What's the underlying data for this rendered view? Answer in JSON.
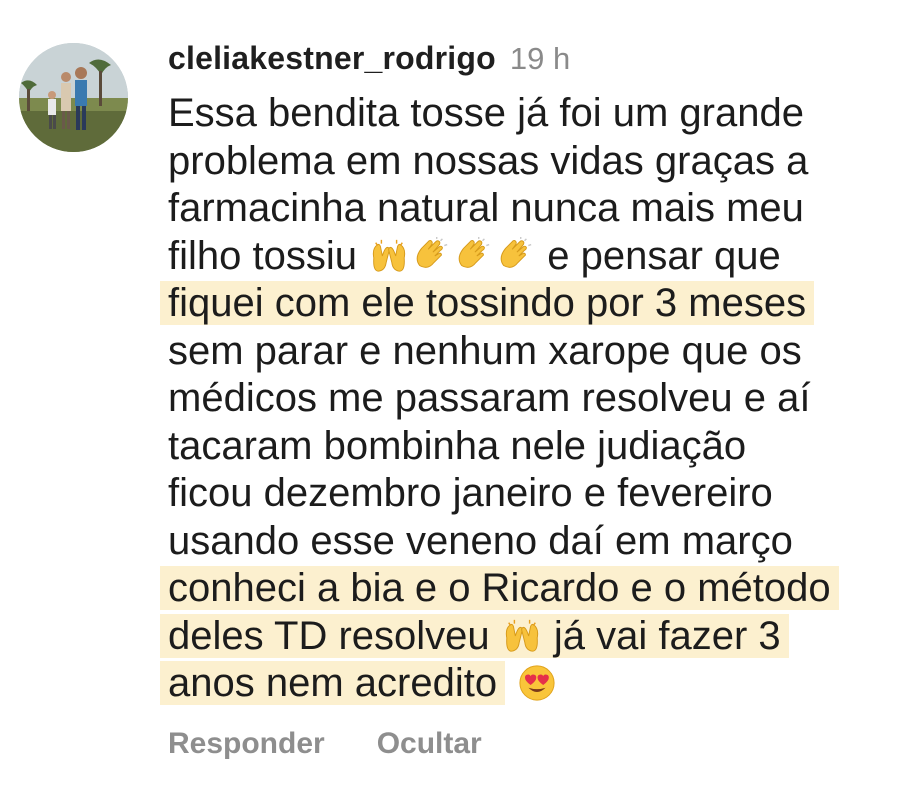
{
  "comment": {
    "username": "cleliakestner_rodrigo",
    "time": "19 h",
    "lines": [
      {
        "text": "Essa bendita tosse já foi um grande"
      },
      {
        "text": "problema em nossas vidas graças a"
      },
      {
        "text": "farmacinha natural nunca mais meu"
      },
      {
        "text_before": "filho tossiu",
        "text_after": "e pensar que",
        "emojis": [
          "raising-hands",
          "clapping-hands",
          "clapping-hands",
          "clapping-hands"
        ]
      },
      {
        "text": "fiquei com ele tossindo por 3 meses",
        "highlight": true
      },
      {
        "text": "sem parar e nenhum xarope que os"
      },
      {
        "text": "médicos me passaram resolveu e aí"
      },
      {
        "text": "tacaram bombinha nele judiação"
      },
      {
        "text": "ficou dezembro janeiro e fevereiro"
      },
      {
        "text": "usando esse veneno daí em março"
      },
      {
        "text": "conheci a bia e o Ricardo e o método",
        "highlight": true
      },
      {
        "text_before": "deles TD resolveu",
        "text_after": "já vai fazer 3",
        "emojis": [
          "raising-hands"
        ],
        "highlight": true
      },
      {
        "text": "anos nem acredito",
        "highlight": true,
        "trailing_emoji": "heart-eyes-face"
      }
    ]
  },
  "actions": {
    "reply_label": "Responder",
    "hide_label": "Ocultar"
  },
  "colors": {
    "highlight": "#fcf0cf",
    "muted": "#8e8e8e",
    "text": "#1c1c1c"
  }
}
